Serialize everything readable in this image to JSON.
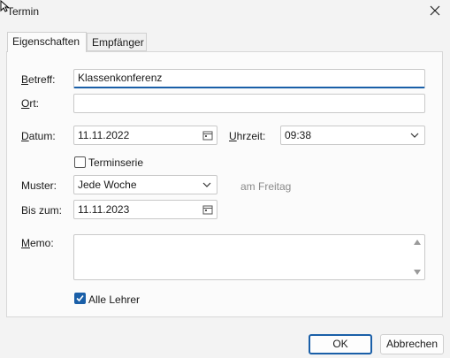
{
  "window": {
    "title": "Termin",
    "close_icon": "close-icon"
  },
  "tabs": [
    {
      "label": "Eigenschaften",
      "active": true
    },
    {
      "label": "Empfänger",
      "active": false
    }
  ],
  "form": {
    "subject": {
      "label": "Betreff:",
      "value": "Klassenkonferenz"
    },
    "location": {
      "label": "Ort:",
      "value": ""
    },
    "date": {
      "label": "Datum:",
      "value": "11.11.2022"
    },
    "time": {
      "label": "Uhrzeit:",
      "value": "09:38"
    },
    "series": {
      "label": "Terminserie",
      "checked": false
    },
    "pattern": {
      "label": "Muster:",
      "value": "Jede Woche",
      "hint": "am Freitag"
    },
    "until": {
      "label": "Bis zum:",
      "value": "11.11.2023"
    },
    "memo": {
      "label": "Memo:",
      "value": ""
    },
    "all_teachers": {
      "label": "Alle Lehrer",
      "checked": true
    }
  },
  "buttons": {
    "ok": "OK",
    "cancel": "Abbrechen"
  },
  "colors": {
    "accent": "#1a5fa8",
    "background": "#f3f3f3",
    "panel": "#fbfbfb"
  }
}
